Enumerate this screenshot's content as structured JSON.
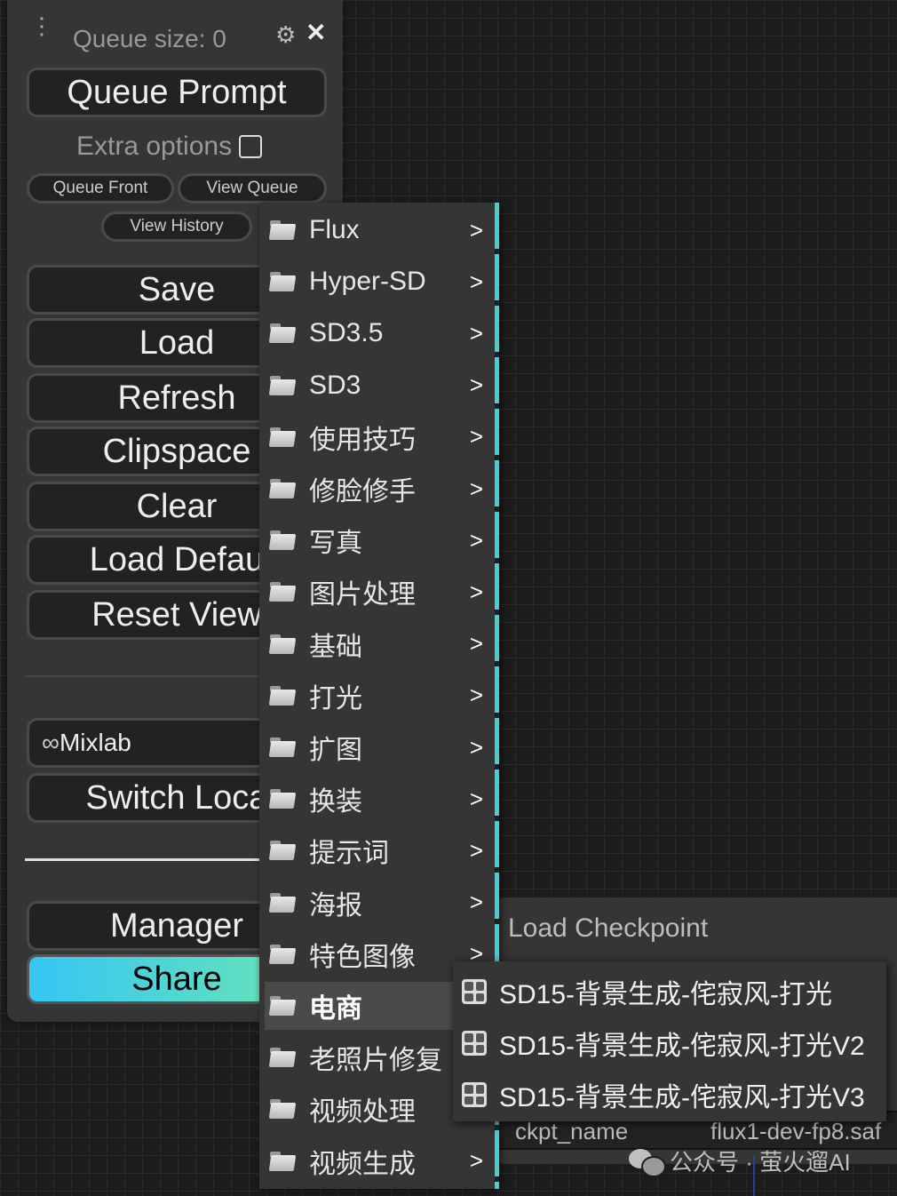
{
  "panel": {
    "queue_size": "Queue size: 0",
    "queue_prompt": "Queue Prompt",
    "extra_options": "Extra options",
    "queue_front": "Queue Front",
    "view_queue": "View Queue",
    "view_history": "View History",
    "buttons": {
      "save": "Save",
      "load": "Load",
      "refresh": "Refresh",
      "clipspace": "Clipspace",
      "clear": "Clear",
      "load_default": "Load Defau",
      "reset_view": "Reset View",
      "mixlab": "Mixlab",
      "switch_locale": "Switch Loca",
      "manager": "Manager",
      "share": "Share"
    },
    "share_gradient": [
      "#35c6f4",
      "#6ee7b0"
    ]
  },
  "context_menu": {
    "items": [
      {
        "label": "Flux"
      },
      {
        "label": "Hyper-SD"
      },
      {
        "label": "SD3.5"
      },
      {
        "label": "SD3"
      },
      {
        "label": "使用技巧"
      },
      {
        "label": "修脸修手"
      },
      {
        "label": "写真"
      },
      {
        "label": "图片处理"
      },
      {
        "label": "基础"
      },
      {
        "label": "打光"
      },
      {
        "label": "扩图"
      },
      {
        "label": "换装"
      },
      {
        "label": "提示词"
      },
      {
        "label": "海报"
      },
      {
        "label": "特色图像"
      },
      {
        "label": "电商"
      },
      {
        "label": "老照片修复"
      },
      {
        "label": "视频处理"
      },
      {
        "label": "视频生成"
      }
    ],
    "arrow": ">",
    "accent_color": "#3fd0d8"
  },
  "submenu": {
    "items": [
      {
        "label": "SD15-背景生成-侘寂风-打光"
      },
      {
        "label": "SD15-背景生成-侘寂风-打光V2"
      },
      {
        "label": "SD15-背景生成-侘寂风-打光V3"
      }
    ]
  },
  "node": {
    "title": "Load Checkpoint",
    "row_left": "ckpt_name",
    "row_right": "flux1-dev-fp8.saf"
  },
  "watermark": "公众号 · 萤火遛AI"
}
